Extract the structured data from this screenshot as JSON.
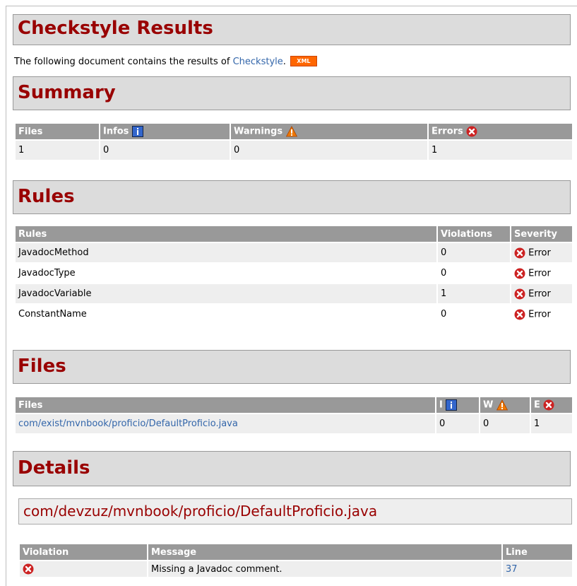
{
  "page": {
    "title": "Checkstyle Results",
    "intro_prefix": "The following document contains the results of ",
    "intro_link": "Checkstyle",
    "intro_suffix": ".",
    "xml_badge": "XML"
  },
  "summary": {
    "heading": "Summary",
    "headers": [
      "Files",
      "Infos",
      "Warnings",
      "Errors"
    ],
    "row": [
      "1",
      "0",
      "0",
      "1"
    ]
  },
  "rules": {
    "heading": "Rules",
    "headers": [
      "Rules",
      "Violations",
      "Severity"
    ],
    "rows": [
      {
        "rule": "JavadocMethod",
        "violations": "0",
        "severity": "Error"
      },
      {
        "rule": "JavadocType",
        "violations": "0",
        "severity": "Error"
      },
      {
        "rule": "JavadocVariable",
        "violations": "1",
        "severity": "Error"
      },
      {
        "rule": "ConstantName",
        "violations": "0",
        "severity": "Error"
      }
    ]
  },
  "files": {
    "heading": "Files",
    "headers": [
      "Files",
      "I",
      "W",
      "E"
    ],
    "rows": [
      {
        "file": "com/exist/mvnbook/proficio/DefaultProficio.java",
        "i": "0",
        "w": "0",
        "e": "1"
      }
    ]
  },
  "details": {
    "heading": "Details",
    "file_title": "com/devzuz/mvnbook/proficio/DefaultProficio.java",
    "headers": [
      "Violation",
      "Message",
      "Line"
    ],
    "rows": [
      {
        "message": "Missing a Javadoc comment.",
        "line": "37"
      }
    ]
  },
  "icons": {
    "info": "info-icon",
    "warning": "warning-icon",
    "error": "error-icon"
  },
  "colors": {
    "heading_text": "#990000",
    "heading_bg": "#dcdcdc",
    "table_header_bg": "#999999",
    "link": "#3366aa",
    "error_icon": "#cc2222",
    "warning_icon": "#ee7700",
    "info_icon": "#3366cc"
  }
}
